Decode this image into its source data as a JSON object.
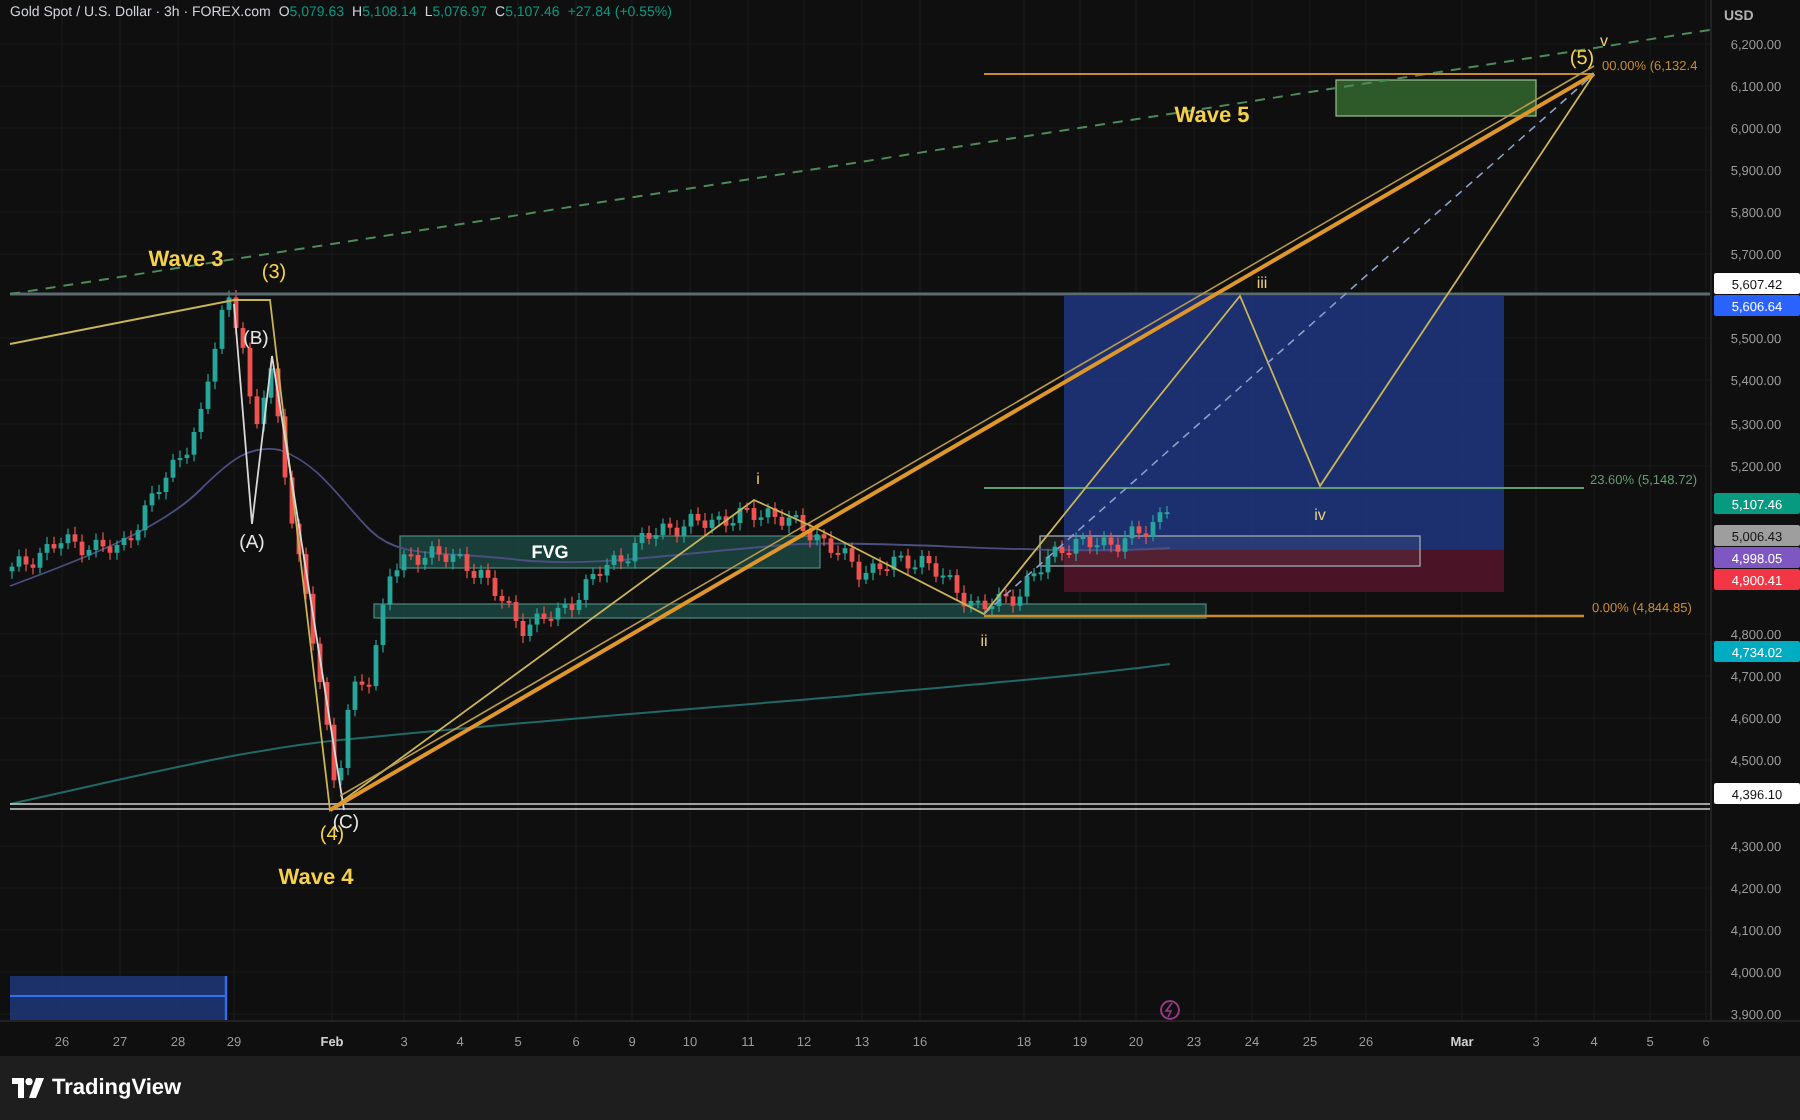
{
  "header": {
    "symbol": "Gold Spot / U.S. Dollar · 3h · FOREX.com",
    "ohlc": [
      {
        "label": "O",
        "value": "5,079.63"
      },
      {
        "label": "H",
        "value": "5,108.14"
      },
      {
        "label": "L",
        "value": "5,076.97"
      },
      {
        "label": "C",
        "value": "5,107.46"
      }
    ],
    "change": "+27.84 (+0.55%)"
  },
  "annotations": [
    {
      "text": "Wave 3",
      "kind": "wave_title"
    },
    {
      "text": "(3)",
      "kind": "wave_degree"
    },
    {
      "text": "(B)",
      "kind": "sub_wave"
    },
    {
      "text": "(A)",
      "kind": "sub_wave"
    },
    {
      "text": "(4)",
      "kind": "wave_degree"
    },
    {
      "text": "(C)",
      "kind": "sub_wave"
    },
    {
      "text": "Wave 4",
      "kind": "wave_title"
    },
    {
      "text": "FVG",
      "kind": "zone"
    },
    {
      "text": "i",
      "kind": "minor_wave"
    },
    {
      "text": "ii",
      "kind": "minor_wave"
    },
    {
      "text": "iii",
      "kind": "minor_wave"
    },
    {
      "text": "iv",
      "kind": "minor_wave"
    },
    {
      "text": "Wave 5",
      "kind": "wave_title"
    },
    {
      "text": "(5)",
      "kind": "wave_degree"
    },
    {
      "text": "v",
      "kind": "minor_wave"
    },
    {
      "text": "00.00% (6,132.4",
      "kind": "fib",
      "color": "#c98a2e"
    },
    {
      "text": "23.60% (5,148.72)",
      "kind": "fib",
      "color": "#5f9e6e"
    },
    {
      "text": "0.00% (4,844.85)",
      "kind": "fib",
      "color": "#c98a2e"
    }
  ],
  "price_axis": {
    "currency": "USD",
    "ticks": [
      "6,200.00",
      "6,100.00",
      "6,000.00",
      "5,900.00",
      "5,800.00",
      "5,700.00",
      "5,500.00",
      "5,400.00",
      "5,300.00",
      "5,200.00",
      "4,800.00",
      "4,700.00",
      "4,600.00",
      "4,500.00",
      "4,300.00",
      "4,200.00",
      "4,100.00",
      "4,000.00",
      "3,900.00"
    ],
    "tags": [
      {
        "value": "5,607.42",
        "color": "#ffffff"
      },
      {
        "value": "5,606.64",
        "color": "#2962ff"
      },
      {
        "value": "5,107.46",
        "color": "#089981"
      },
      {
        "value": "5,006.43",
        "color": "#9e9e9e"
      },
      {
        "value": "4,998.05",
        "color": "#7e57c2"
      },
      {
        "value": "4,900.41",
        "color": "#f23645"
      },
      {
        "value": "4,734.02",
        "color": "#00acc1"
      },
      {
        "value": "4,396.10",
        "color": "#ffffff"
      }
    ]
  },
  "time_axis": [
    {
      "label": "26",
      "kind": "day"
    },
    {
      "label": "27",
      "kind": "day"
    },
    {
      "label": "28",
      "kind": "day"
    },
    {
      "label": "29",
      "kind": "day"
    },
    {
      "label": "Feb",
      "kind": "month"
    },
    {
      "label": "3",
      "kind": "day"
    },
    {
      "label": "4",
      "kind": "day"
    },
    {
      "label": "5",
      "kind": "day"
    },
    {
      "label": "6",
      "kind": "day"
    },
    {
      "label": "9",
      "kind": "day"
    },
    {
      "label": "10",
      "kind": "day"
    },
    {
      "label": "11",
      "kind": "day"
    },
    {
      "label": "12",
      "kind": "day"
    },
    {
      "label": "13",
      "kind": "day"
    },
    {
      "label": "16",
      "kind": "day"
    },
    {
      "label": "18",
      "kind": "day"
    },
    {
      "label": "19",
      "kind": "day"
    },
    {
      "label": "20",
      "kind": "day"
    },
    {
      "label": "23",
      "kind": "day"
    },
    {
      "label": "24",
      "kind": "day"
    },
    {
      "label": "25",
      "kind": "day"
    },
    {
      "label": "26",
      "kind": "day"
    },
    {
      "label": "Mar",
      "kind": "month"
    },
    {
      "label": "3",
      "kind": "day"
    },
    {
      "label": "4",
      "kind": "day"
    },
    {
      "label": "5",
      "kind": "day"
    },
    {
      "label": "6",
      "kind": "day"
    }
  ],
  "footer": {
    "brand": "TradingView"
  }
}
